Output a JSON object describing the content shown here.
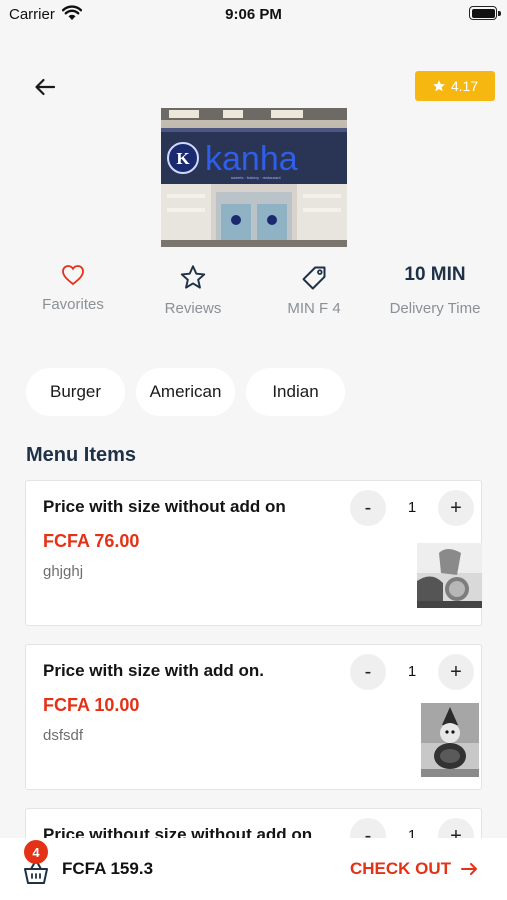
{
  "status_bar": {
    "carrier": "Carrier",
    "time": "9:06 PM"
  },
  "header": {
    "rating": "4.17",
    "back_icon": "arrow-left-icon",
    "rating_icon": "star-icon"
  },
  "restaurant": {
    "banner_text": "kanha",
    "banner_tagline": "sweets · bakery · restaurant"
  },
  "stats": [
    {
      "label": "Favorites",
      "icon": "heart-icon"
    },
    {
      "label": "Reviews",
      "icon": "star-outline-icon"
    },
    {
      "label": "MIN F 4",
      "icon": "tag-icon"
    },
    {
      "value": "10 MIN",
      "label": "Delivery Time"
    }
  ],
  "categories": [
    "Burger",
    "American",
    "Indian"
  ],
  "menu": {
    "title": "Menu Items",
    "items": [
      {
        "name": "Price with size without add on",
        "price": "FCFA 76.00",
        "desc": "ghjghj",
        "qty": "1"
      },
      {
        "name": "Price with size with add on.",
        "price": "FCFA 10.00",
        "desc": "dsfsdf",
        "qty": "1"
      },
      {
        "name": "Price without size without add on",
        "qty": "1"
      }
    ],
    "minus": "-",
    "plus": "+"
  },
  "cart": {
    "count": "4",
    "total": "FCFA 159.3",
    "checkout": "CHECK OUT",
    "basket_icon": "basket-icon",
    "checkout_icon": "arrow-right-icon"
  },
  "colors": {
    "accent": "#e53116",
    "rating_bg": "#f6b810",
    "heading": "#1e3146"
  }
}
